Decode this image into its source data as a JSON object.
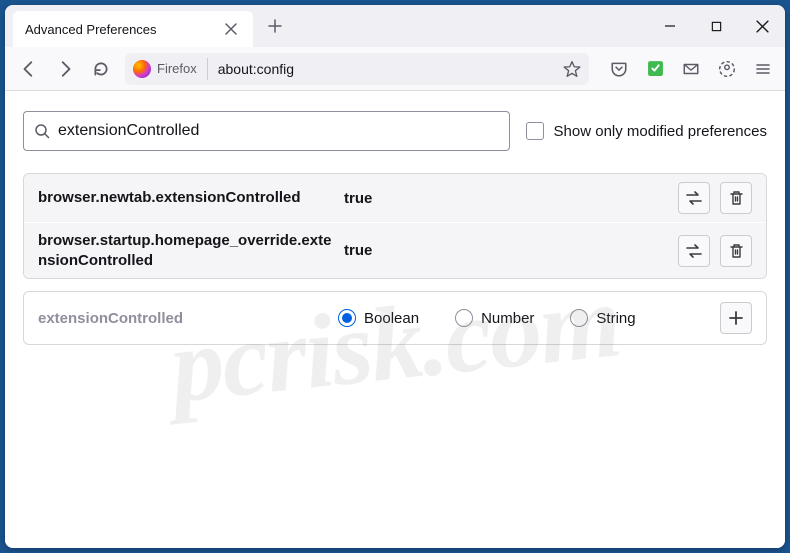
{
  "titlebar": {
    "tab_title": "Advanced Preferences"
  },
  "nav": {
    "identity_label": "Firefox",
    "url": "about:config"
  },
  "search": {
    "value": "extensionControlled",
    "show_modified_label": "Show only modified preferences"
  },
  "prefs": [
    {
      "name": "browser.newtab.extensionControlled",
      "value": "true"
    },
    {
      "name": "browser.startup.homepage_override.extensionControlled",
      "value": "true"
    }
  ],
  "add": {
    "name": "extensionControlled",
    "types": [
      "Boolean",
      "Number",
      "String"
    ],
    "selected": "Boolean"
  },
  "watermark": "pcrisk.com"
}
